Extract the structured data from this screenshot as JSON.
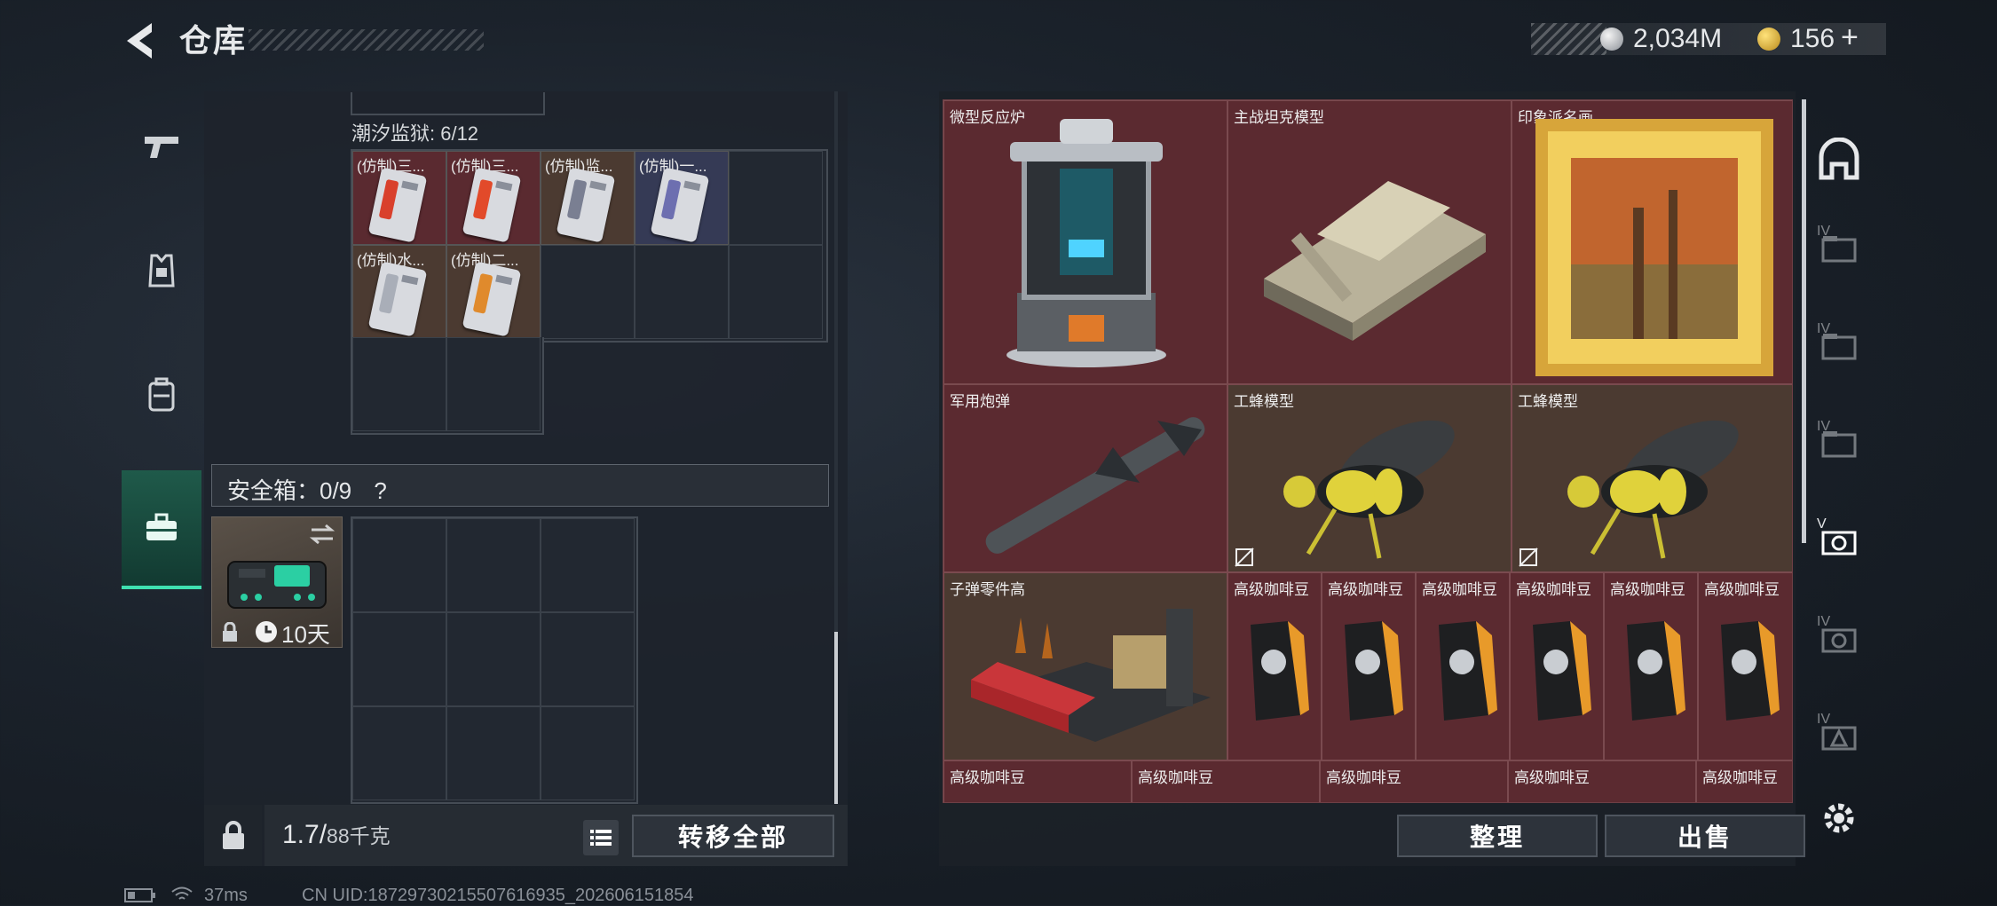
{
  "header": {
    "title": "仓库",
    "currency_primary": "2,034M",
    "currency_secondary": "156",
    "add_label": "+"
  },
  "left_tabs": [
    {
      "name": "pistol-tab",
      "icon": "pistol-icon"
    },
    {
      "name": "armor-tab",
      "icon": "armor-icon"
    },
    {
      "name": "backpack-tab",
      "icon": "backpack-icon"
    },
    {
      "name": "safebox-tab",
      "icon": "briefcase-icon",
      "active": true
    }
  ],
  "collection": {
    "label": "潮汐监狱: 6/12",
    "items": [
      {
        "name": "(仿制)三...",
        "strip": "#d9402c"
      },
      {
        "name": "(仿制)三...",
        "strip": "#e24a2a"
      },
      {
        "name": "(仿制)监...",
        "strip": "#7a7f92"
      },
      {
        "name": "(仿制)一...",
        "strip": "#6d6fb0"
      },
      {
        "name": "(仿制)水...",
        "strip": "#a9aeb8"
      },
      {
        "name": "(仿制)二...",
        "strip": "#e08a2c"
      }
    ]
  },
  "safe_box": {
    "label": "安全箱：0/9",
    "help": "?",
    "swap_icon": "swap-icon",
    "timer": "10天"
  },
  "bottom_left": {
    "weight_value": "1.7/",
    "weight_unit": "88千克",
    "transfer_all": "转移全部"
  },
  "stash": {
    "items": [
      {
        "name": "微型反应炉",
        "color": "red"
      },
      {
        "name": "主战坦克模型",
        "color": "red"
      },
      {
        "name": "印象派名画",
        "color": "red"
      },
      {
        "name": "军用炮弹",
        "color": "red"
      },
      {
        "name": "工蜂模型",
        "color": "brown"
      },
      {
        "name": "工蜂模型",
        "color": "brown"
      },
      {
        "name": "子弹零件高",
        "color": "brown"
      },
      {
        "name": "高级咖啡豆",
        "color": "red"
      },
      {
        "name": "高级咖啡豆",
        "color": "red"
      },
      {
        "name": "高级咖啡豆",
        "color": "red"
      },
      {
        "name": "高级咖啡豆",
        "color": "red"
      },
      {
        "name": "高级咖啡豆",
        "color": "red"
      },
      {
        "name": "高级咖啡豆",
        "color": "red"
      },
      {
        "name": "高级咖啡豆",
        "color": "red"
      },
      {
        "name": "高级咖啡豆",
        "color": "red"
      },
      {
        "name": "高级咖啡豆",
        "color": "red"
      },
      {
        "name": "高级咖啡豆",
        "color": "red"
      },
      {
        "name": "高级咖啡豆",
        "color": "red"
      }
    ]
  },
  "right_tabs": [
    "home-tab",
    "stash-iv-1",
    "stash-iv-2",
    "stash-iv-3",
    "stash-v-active",
    "stash-iv-4",
    "stash-iv-5"
  ],
  "right_tab_labels": [
    "IV",
    "IV",
    "IV",
    "V",
    "IV",
    "IV"
  ],
  "bottom_right": {
    "sort": "整理",
    "sell": "出售"
  },
  "footer": {
    "ping": "37ms",
    "uid": "CN UID:18729730215507616935_202606151854"
  }
}
